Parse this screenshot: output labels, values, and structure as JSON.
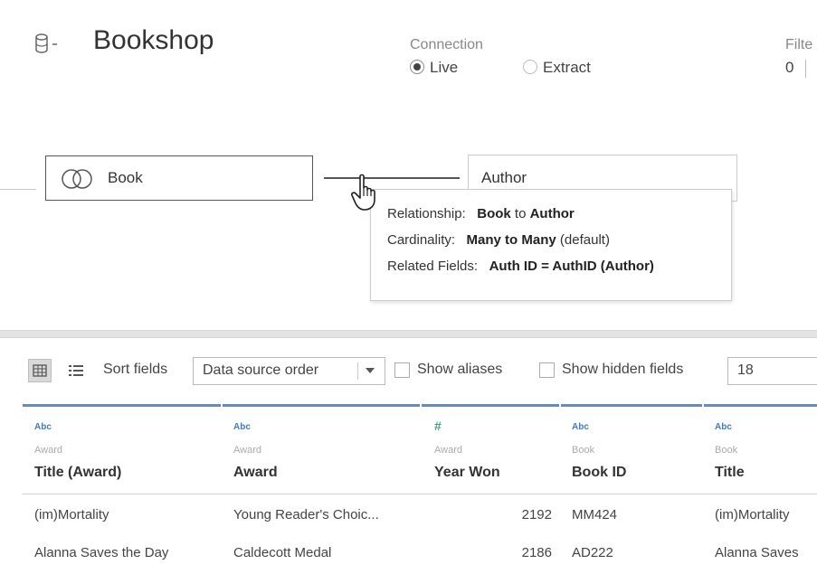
{
  "header": {
    "title": "Bookshop",
    "connection_label": "Connection",
    "live_label": "Live",
    "extract_label": "Extract",
    "filters_label": "Filte",
    "filters_count": "0"
  },
  "canvas": {
    "left_table": "Book",
    "right_table": "Author",
    "tooltip": {
      "relationship_label": "Relationship:",
      "relationship_left": "Book",
      "relationship_to": "to",
      "relationship_right": "Author",
      "cardinality_label": "Cardinality:",
      "cardinality_value": "Many to Many",
      "cardinality_note": "(default)",
      "fields_label": "Related Fields:",
      "fields_value": "Auth ID = AuthID (Author)"
    }
  },
  "toolbar": {
    "sort_label": "Sort fields",
    "sort_value": "Data source order",
    "show_aliases": "Show aliases",
    "show_hidden": "Show hidden fields",
    "rows_value": "18"
  },
  "grid": {
    "columns": [
      {
        "type": "Abc",
        "source": "Award",
        "name": "Title (Award)"
      },
      {
        "type": "Abc",
        "source": "Award",
        "name": "Award"
      },
      {
        "type": "#",
        "source": "Award",
        "name": "Year Won"
      },
      {
        "type": "Abc",
        "source": "Book",
        "name": "Book ID"
      },
      {
        "type": "Abc",
        "source": "Book",
        "name": "Title"
      }
    ],
    "rows": [
      [
        "(im)Mortality",
        "Young Reader's Choic...",
        "2192",
        "MM424",
        "(im)Mortality"
      ],
      [
        "Alanna Saves the Day",
        "Caldecott Medal",
        "2186",
        "AD222",
        "Alanna Saves"
      ]
    ]
  },
  "colors": {
    "accent": "#5b8fc9",
    "string_type": "#4a79b8",
    "number_type": "#3aa67b"
  },
  "icons": [
    "database-icon",
    "join-venn-icon",
    "hand-cursor-icon",
    "grid-view-icon",
    "list-view-icon"
  ]
}
